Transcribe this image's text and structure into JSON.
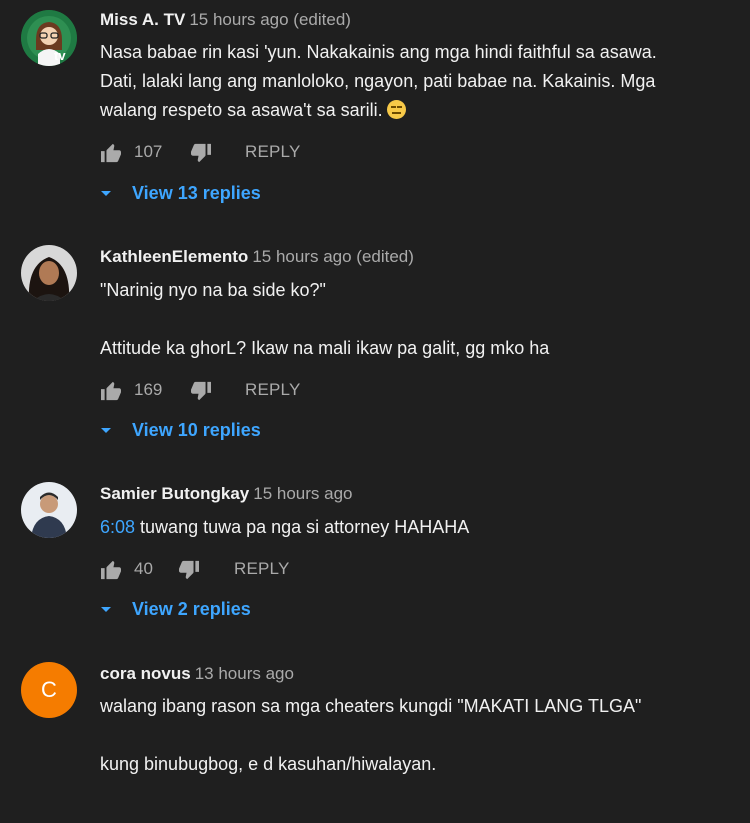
{
  "comments": [
    {
      "author": "Miss A. TV",
      "time": "15 hours ago (edited)",
      "avatar_label": "tv",
      "lines": [
        "Nasa babae rin kasi 'yun. Nakakainis ang mga hindi faithful sa asawa. Dati, lalaki lang ang manloloko, ngayon, pati babae na. Kakainis. Mga walang respeto sa asawa't sa sarili."
      ],
      "likes": "107",
      "reply_label": "REPLY",
      "view_replies": "View 13 replies"
    },
    {
      "author": "KathleenElemento",
      "time": "15 hours ago (edited)",
      "line1": "\"Narinig nyo na ba side ko?\"",
      "line2": "Attitude ka ghorL? Ikaw na mali ikaw pa galit, gg mko ha",
      "likes": "169",
      "reply_label": "REPLY",
      "view_replies": "View 10 replies"
    },
    {
      "author": "Samier Butongkay",
      "time": "15 hours ago",
      "timestamp_link": "6:08",
      "text": " tuwang tuwa pa nga si attorney HAHAHA",
      "likes": "40",
      "reply_label": "REPLY",
      "view_replies": "View 2 replies"
    },
    {
      "author": "cora novus",
      "time": "13 hours ago",
      "avatar_letter": "C",
      "avatar_color": "#f57c00",
      "line1": "walang ibang rason sa mga cheaters kungdi \"MAKATI LANG TLGA\"",
      "line2": "kung binubugbog, e d kasuhan/hiwalayan."
    }
  ],
  "colors": {
    "background": "#1f1f1f",
    "link": "#3ea6ff",
    "muted": "#aaaaaa"
  },
  "icons": [
    "thumb-up-icon",
    "thumb-down-icon",
    "caret-down-icon",
    "emoji-expressionless-icon"
  ]
}
